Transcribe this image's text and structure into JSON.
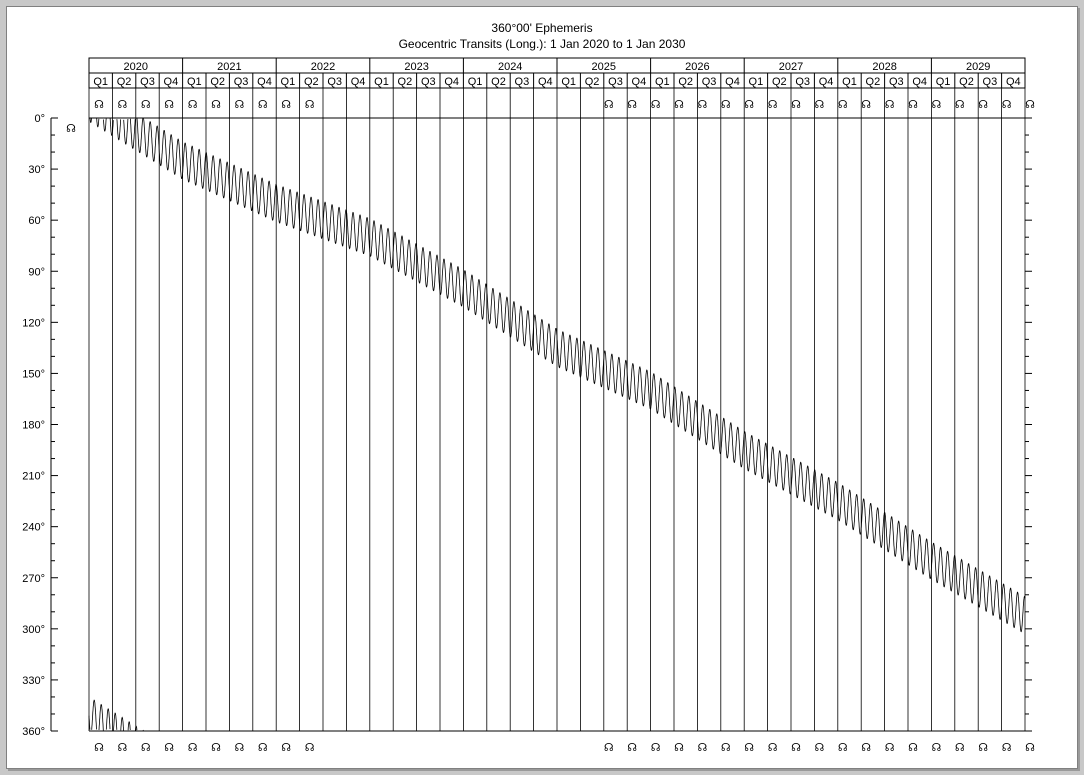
{
  "chart_data": {
    "type": "line",
    "title": "360°00' Ephemeris",
    "subtitle": "Geocentric Transits (Long.): 1 Jan 2020 to 1 Jan 2030",
    "x_start": "2020-01-01",
    "x_end": "2030-01-01",
    "years": [
      "2020",
      "2021",
      "2022",
      "2023",
      "2024",
      "2025",
      "2026",
      "2027",
      "2028",
      "2029"
    ],
    "quarters": [
      "Q1",
      "Q2",
      "Q3",
      "Q4"
    ],
    "ylim": [
      0,
      360
    ],
    "y_inverted": true,
    "y_ticks": [
      "0°",
      "30°",
      "60°",
      "90°",
      "120°",
      "150°",
      "180°",
      "210°",
      "240°",
      "270°",
      "300°",
      "330°",
      "360°"
    ],
    "grid": "vertical lines at each quarter",
    "series": [
      {
        "name": "",
        "glyph": "☊",
        "x": [
          "2020-01-01",
          "2021-01-01",
          "2022-01-01",
          "2023-01-01",
          "2024-01-01",
          "2025-01-01",
          "2026-01-01",
          "2027-01-01",
          "2028-01-01",
          "2029-01-01",
          "2030-01-01"
        ],
        "values": [
          -9,
          25,
          50,
          70,
          100,
          135,
          160,
          195,
          225,
          260,
          292
        ],
        "oscillation_amplitude_deg": 11
      }
    ],
    "top_glyphs": "☊",
    "bottom_glyphs": "☊"
  }
}
